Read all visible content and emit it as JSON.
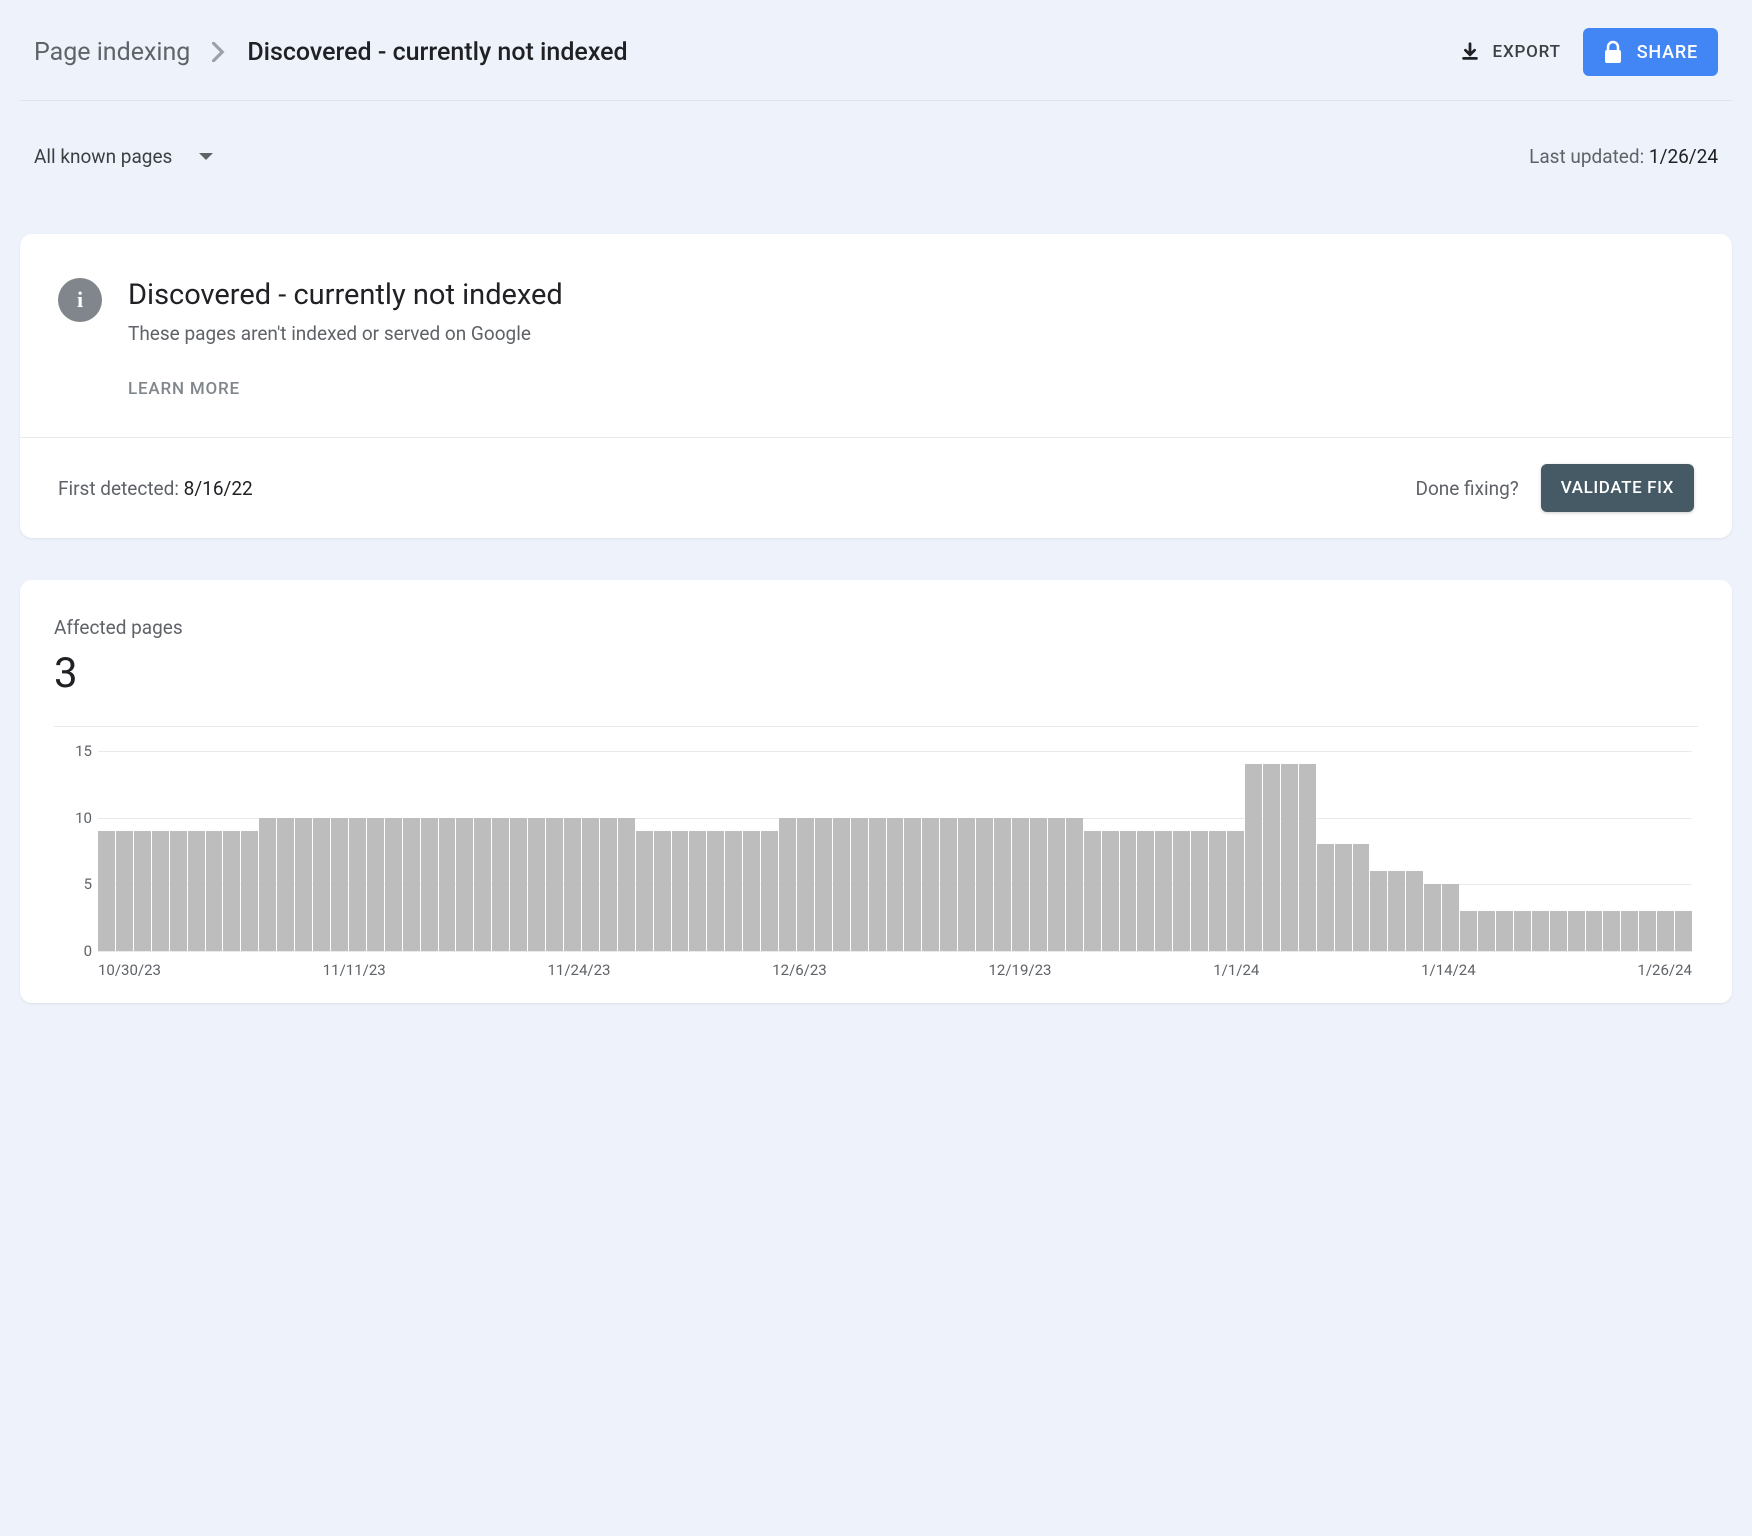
{
  "header": {
    "breadcrumb_parent": "Page indexing",
    "breadcrumb_current": "Discovered - currently not indexed",
    "export_label": "EXPORT",
    "share_label": "SHARE"
  },
  "filter": {
    "selected": "All known pages",
    "last_updated_label": "Last updated: ",
    "last_updated_date": "1/26/24"
  },
  "issue": {
    "title": "Discovered - currently not indexed",
    "subtitle": "These pages aren't indexed or served on Google",
    "learn_more": "LEARN MORE",
    "first_detected_label": "First detected: ",
    "first_detected_date": "8/16/22",
    "done_fixing": "Done fixing?",
    "validate_label": "VALIDATE FIX"
  },
  "affected": {
    "label": "Affected pages",
    "count": "3"
  },
  "chart_data": {
    "type": "bar",
    "ylabel": "",
    "xlabel": "",
    "ylim": [
      0,
      15
    ],
    "y_ticks": [
      0,
      5,
      10,
      15
    ],
    "x_ticks": [
      "10/30/23",
      "11/11/23",
      "11/24/23",
      "12/6/23",
      "12/19/23",
      "1/1/24",
      "1/14/24",
      "1/26/24"
    ],
    "values": [
      9,
      9,
      9,
      9,
      9,
      9,
      9,
      9,
      9,
      10,
      10,
      10,
      10,
      10,
      10,
      10,
      10,
      10,
      10,
      10,
      10,
      10,
      10,
      10,
      10,
      10,
      10,
      10,
      10,
      10,
      9,
      9,
      9,
      9,
      9,
      9,
      9,
      9,
      10,
      10,
      10,
      10,
      10,
      10,
      10,
      10,
      10,
      10,
      10,
      10,
      10,
      10,
      10,
      10,
      10,
      9,
      9,
      9,
      9,
      9,
      9,
      9,
      9,
      9,
      14,
      14,
      14,
      14,
      8,
      8,
      8,
      6,
      6,
      6,
      5,
      5,
      3,
      3,
      3,
      3,
      3,
      3,
      3,
      3,
      3,
      3,
      3,
      3,
      3
    ],
    "categories": []
  }
}
